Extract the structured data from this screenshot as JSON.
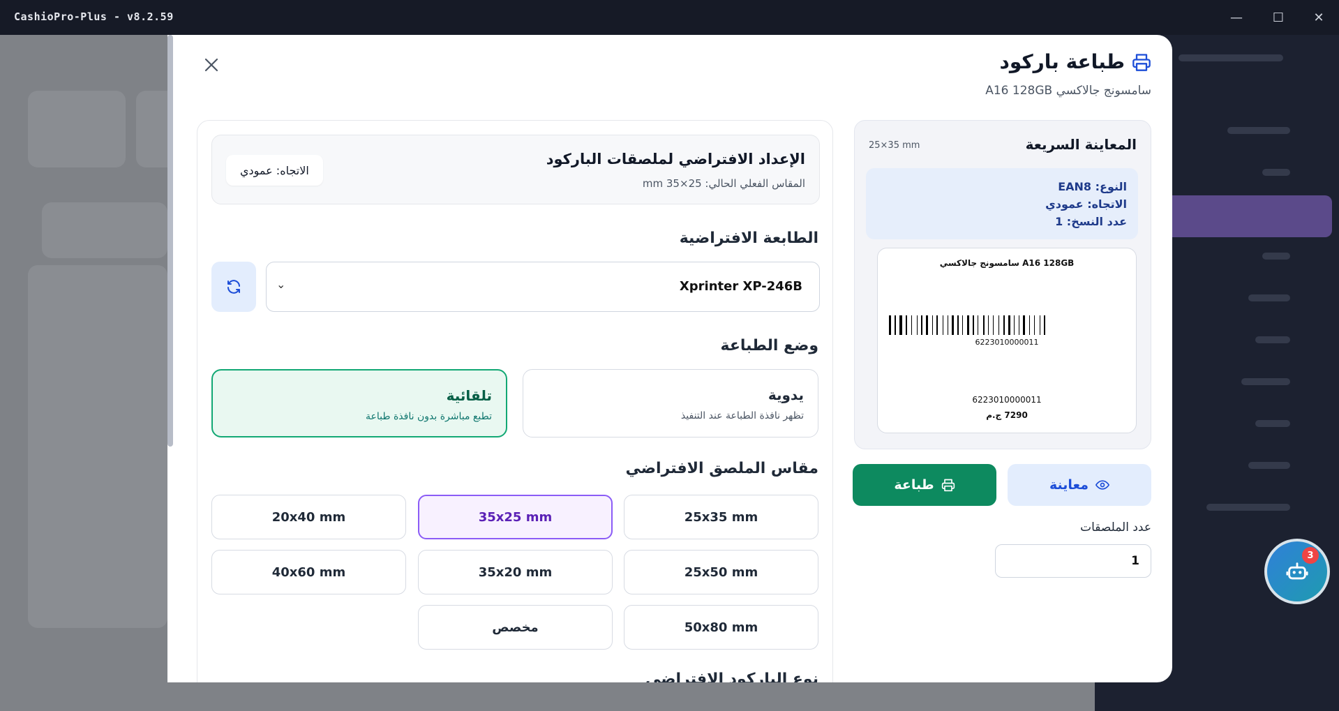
{
  "window": {
    "title": "CashioPro-Plus - v8.2.59",
    "controls": {
      "minimize": "—",
      "maximize": "☐",
      "close": "✕"
    }
  },
  "modal": {
    "title": "طباعة باركود",
    "product_name": "سامسونج جالاكسي A16 128GB",
    "close_icon": "close-icon",
    "preview": {
      "title": "المعاينة السريعة",
      "size": "25×35 mm",
      "type_line": "النوع: EAN8",
      "orientation_line": "الاتجاه: عمودي",
      "copies_line": "عدد النسخ: 1",
      "label": {
        "name": "سامسونج جالاكسي A16 128GB",
        "barcode_text": "6223010000011",
        "code": "6223010000011",
        "price": "7290 ج.م"
      }
    },
    "actions": {
      "preview_label": "معاينة",
      "print_label": "طباعة"
    },
    "count": {
      "label": "عدد الملصقات",
      "value": "1"
    },
    "settings": {
      "default_title": "الإعداد الافتراضي لملصقات الباركود",
      "default_sub": "المقاس الفعلي الحالي: 25×35 mm",
      "orientation_badge": "الاتجاه: عمودي",
      "printer_section": "الطابعة الافتراضية",
      "printer_value": "Xprinter XP-246B",
      "mode_section": "وضع الطباعة",
      "modes": [
        {
          "title": "يدوية",
          "sub": "تظهر نافذة الطباعة عند التنفيذ"
        },
        {
          "title": "تلقائية",
          "sub": "تطبع مباشرة بدون نافذة طباعة"
        }
      ],
      "selected_mode": "تلقائية",
      "size_section": "مقاس الملصق الافتراضي",
      "sizes": [
        "25x35 mm",
        "35x25 mm",
        "20x40 mm",
        "25x50 mm",
        "35x20 mm",
        "40x60 mm",
        "50x80 mm",
        "مخصص"
      ],
      "selected_size": "35x25 mm",
      "barcode_type_section": "نوع الباركود الافتراضي"
    }
  },
  "assistant": {
    "badge_count": "3",
    "icon": "robot-icon"
  },
  "colors": {
    "accent_green": "#0d8a5f",
    "accent_purple": "#8b5cf6",
    "accent_blue": "#1d4ed8"
  }
}
